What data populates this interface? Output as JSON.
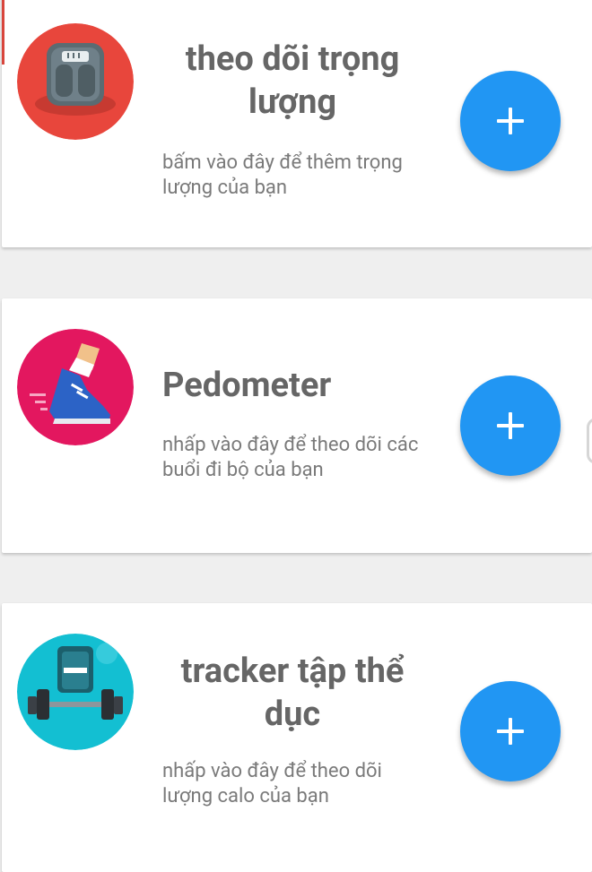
{
  "cards": [
    {
      "title": "theo dõi trọng lượng",
      "description": "bấm vào đây để thêm trọng lượng của bạn",
      "icon": "weight-scale-icon",
      "icon_bg": "#e8463c",
      "add_button": "+"
    },
    {
      "title": "Pedometer",
      "description": "nhấp vào đây để theo dõi các buổi đi bộ của bạn",
      "icon": "running-shoe-icon",
      "icon_bg": "#e3175f",
      "add_button": "+"
    },
    {
      "title": "tracker tập thể dục",
      "description": "nhấp vào đây để theo dõi lượng calo của bạn",
      "icon": "fitness-dumbbell-icon",
      "icon_bg": "#13bfd2",
      "add_button": "+"
    }
  ],
  "colors": {
    "fab": "#2196f3",
    "background": "#efefef",
    "card": "#ffffff"
  }
}
